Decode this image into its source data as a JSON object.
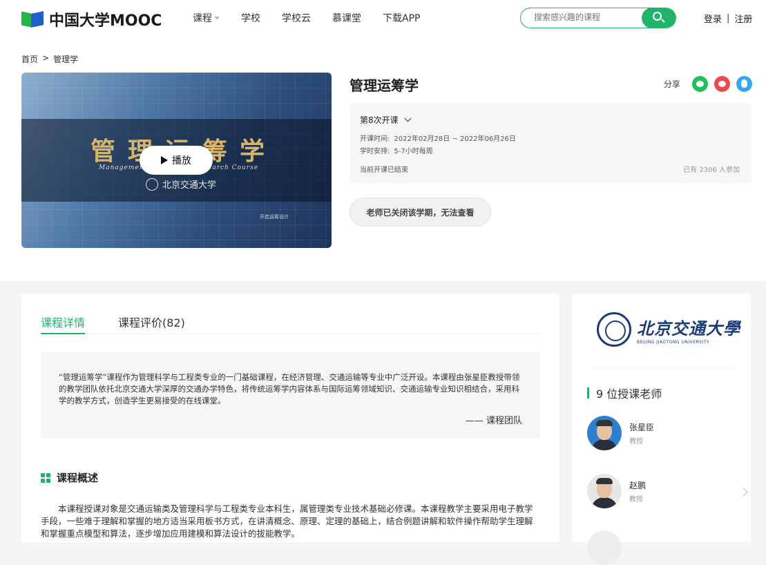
{
  "header": {
    "logo_text": "中国大学MOOC",
    "nav": [
      "课程",
      "学校",
      "学校云",
      "慕课堂",
      "下载APP"
    ],
    "search_placeholder": "搜索感兴趣的课程",
    "login": "登录",
    "register": "注册",
    "auth_sep": "|"
  },
  "breadcrumb": {
    "home": "首页",
    "sep": ">",
    "current": "管理学"
  },
  "video": {
    "title_cn": "管理运筹学",
    "title_en": "Management Operations Research Course",
    "school": "北京交通大学",
    "play_label": "播放",
    "tag": "开启运筹设计"
  },
  "course": {
    "title": "管理运筹学",
    "share_label": "分享",
    "share_icons": [
      "wechat-icon",
      "weibo-icon",
      "qq-icon"
    ],
    "term": "第8次开课",
    "time_label": "开课时间:",
    "time_value": "2022年02月28日 ~ 2022年06月26日",
    "hours_label": "学时安排:",
    "hours_value": "5-7小时每周",
    "status": "当前开课已结束",
    "enrolled": "已有 2306 人参加",
    "closed_notice": "老师已关闭该学期，无法查看"
  },
  "tabs": {
    "detail": "课程详情",
    "reviews": "课程评价(82)"
  },
  "quote": {
    "text": "“管理运筹学”课程作为管理科学与工程类专业的一门基础课程，在经济管理、交通运输等专业中广泛开设。本课程由张星臣教授带领的教学团队依托北京交通大学深厚的交通办学特色，将传统运筹学内容体系与国际运筹领域知识、交通运输专业知识相结合，采用科学的教学方式，创造学生更易接受的在线课堂。",
    "author": "—— 课程团队"
  },
  "overview": {
    "heading": "课程概述",
    "text": "本课程授课对象是交通运输类及管理科学与工程类专业本科生，属管理类专业技术基础必修课。本课程教学主要采用电子教学手段，一些难于理解和掌握的地方适当采用板书方式，在讲清概念、原理、定理的基础上，结合例题讲解和软件操作帮助学生理解和掌握重点模型和算法，逐步增加应用建模和算法设计的拔能教学。"
  },
  "side": {
    "university_cn": "北京交通大學",
    "university_en": "BEIJING JIAOTONG UNIVERSITY",
    "teacher_count": "9 位授课老师",
    "teachers": [
      {
        "name": "张星臣",
        "title": "教授"
      },
      {
        "name": "赵鹏",
        "title": "教授"
      }
    ]
  },
  "colors": {
    "accent": "#21b36a",
    "university": "#1d3a7a"
  }
}
